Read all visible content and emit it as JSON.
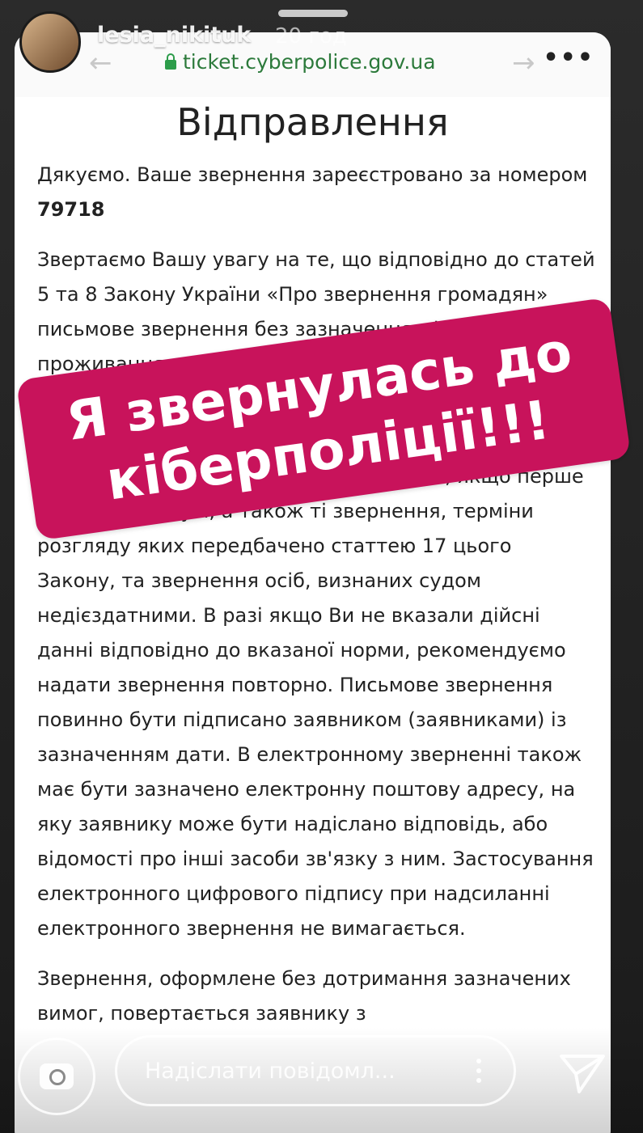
{
  "story": {
    "username": "lesia_nikituk",
    "timestamp": "20 год"
  },
  "browser": {
    "back_icon": "arrow-left-icon",
    "forward_icon": "arrow-right-icon",
    "url": "ticket.cyberpolice.gov.ua",
    "more_icon": "more-horizontal-icon"
  },
  "page": {
    "title": "Відправлення",
    "p1_text": "Дякуємо. Ваше звернення зареєстровано за номером ",
    "p1_number": "79718",
    "p2": "Звертаємо Вашу увагу на те, що відповідно до статей 5 та 8 Закону України «Про звернення громадян» письмове звернення без зазначення місця проживання...",
    "p3": "...же ... громадянина з одн... звернення, якщо перше вирішено по суті, а також ті звернення, терміни розгляду яких передбачено статтею 17 цього Закону, та звернення осіб, визнаних судом недієздатними. В разі якщо Ви не вказали дійсні данні відповідно до вказаної норми, рекомендуємо надати звернення повторно. Письмове звернення повинно бути підписано заявником (заявниками) із зазначенням дати. В електронному зверненні також має бути зазначено електронну поштову адресу, на яку заявнику може бути надіслано відповідь, або відомості про інші засоби зв'язку з ним. Застосування електронного цифрового підпису при надсиланні електронного звернення не вимагається.",
    "p4": "Звернення, оформлене без дотримання зазначених вимог, повертається заявнику з"
  },
  "sticker": {
    "line1": "Я звернулась до",
    "line2": "кіберполіції!!!",
    "color": "#c8135b"
  },
  "footer": {
    "camera_icon": "camera-icon",
    "message_placeholder": "Надіслати повідомл...",
    "options_icon": "kebab-icon",
    "send_icon": "send-icon"
  }
}
